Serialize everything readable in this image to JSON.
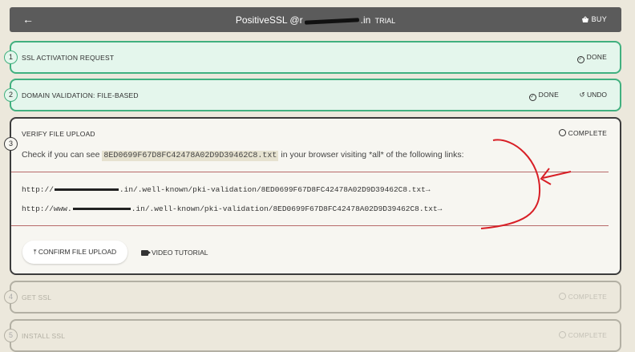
{
  "header": {
    "back_icon": "arrow-left-icon",
    "back": "←",
    "title": "PositiveSSL @r",
    "title_suffix": ".in",
    "trial": "TRIAL",
    "buy": "BUY",
    "buy_icon": "basket-icon"
  },
  "steps": [
    {
      "num": "1",
      "label": "SSL ACTIVATION REQUEST",
      "status": "DONE",
      "status_icon": "check-circle-icon"
    },
    {
      "num": "2",
      "label": "DOMAIN VALIDATION: FILE-BASED",
      "status": "DONE",
      "undo": "UNDO",
      "status_icon": "check-circle-icon",
      "undo_icon": "undo-icon"
    },
    {
      "num": "3",
      "label": "VERIFY FILE UPLOAD",
      "status": "COMPLETE",
      "status_icon": "circle-icon"
    },
    {
      "num": "4",
      "label": "GET SSL",
      "status": "COMPLETE"
    },
    {
      "num": "5",
      "label": "INSTALL SSL",
      "status": "COMPLETE"
    }
  ],
  "verify": {
    "instr_pre": "Check if you can see",
    "filename": "8ED0699F67D8FC42478A02D9D39462C8.txt",
    "instr_post": "in your browser visiting *all* of the following links:",
    "link1_pre": "http://",
    "link1_post": ".in/.well-known/pki-validation/8ED0699F67D8FC42478A02D9D39462C8.txt→",
    "link2_pre": "http://www.",
    "link2_post": ".in/.well-known/pki-validation/8ED0699F67D8FC42478A02D9D39462C8.txt→",
    "confirm_button": "CONFIRM FILE UPLOAD",
    "video_tutorial": "VIDEO TUTORIAL",
    "annotation_color": "#d81f26"
  }
}
